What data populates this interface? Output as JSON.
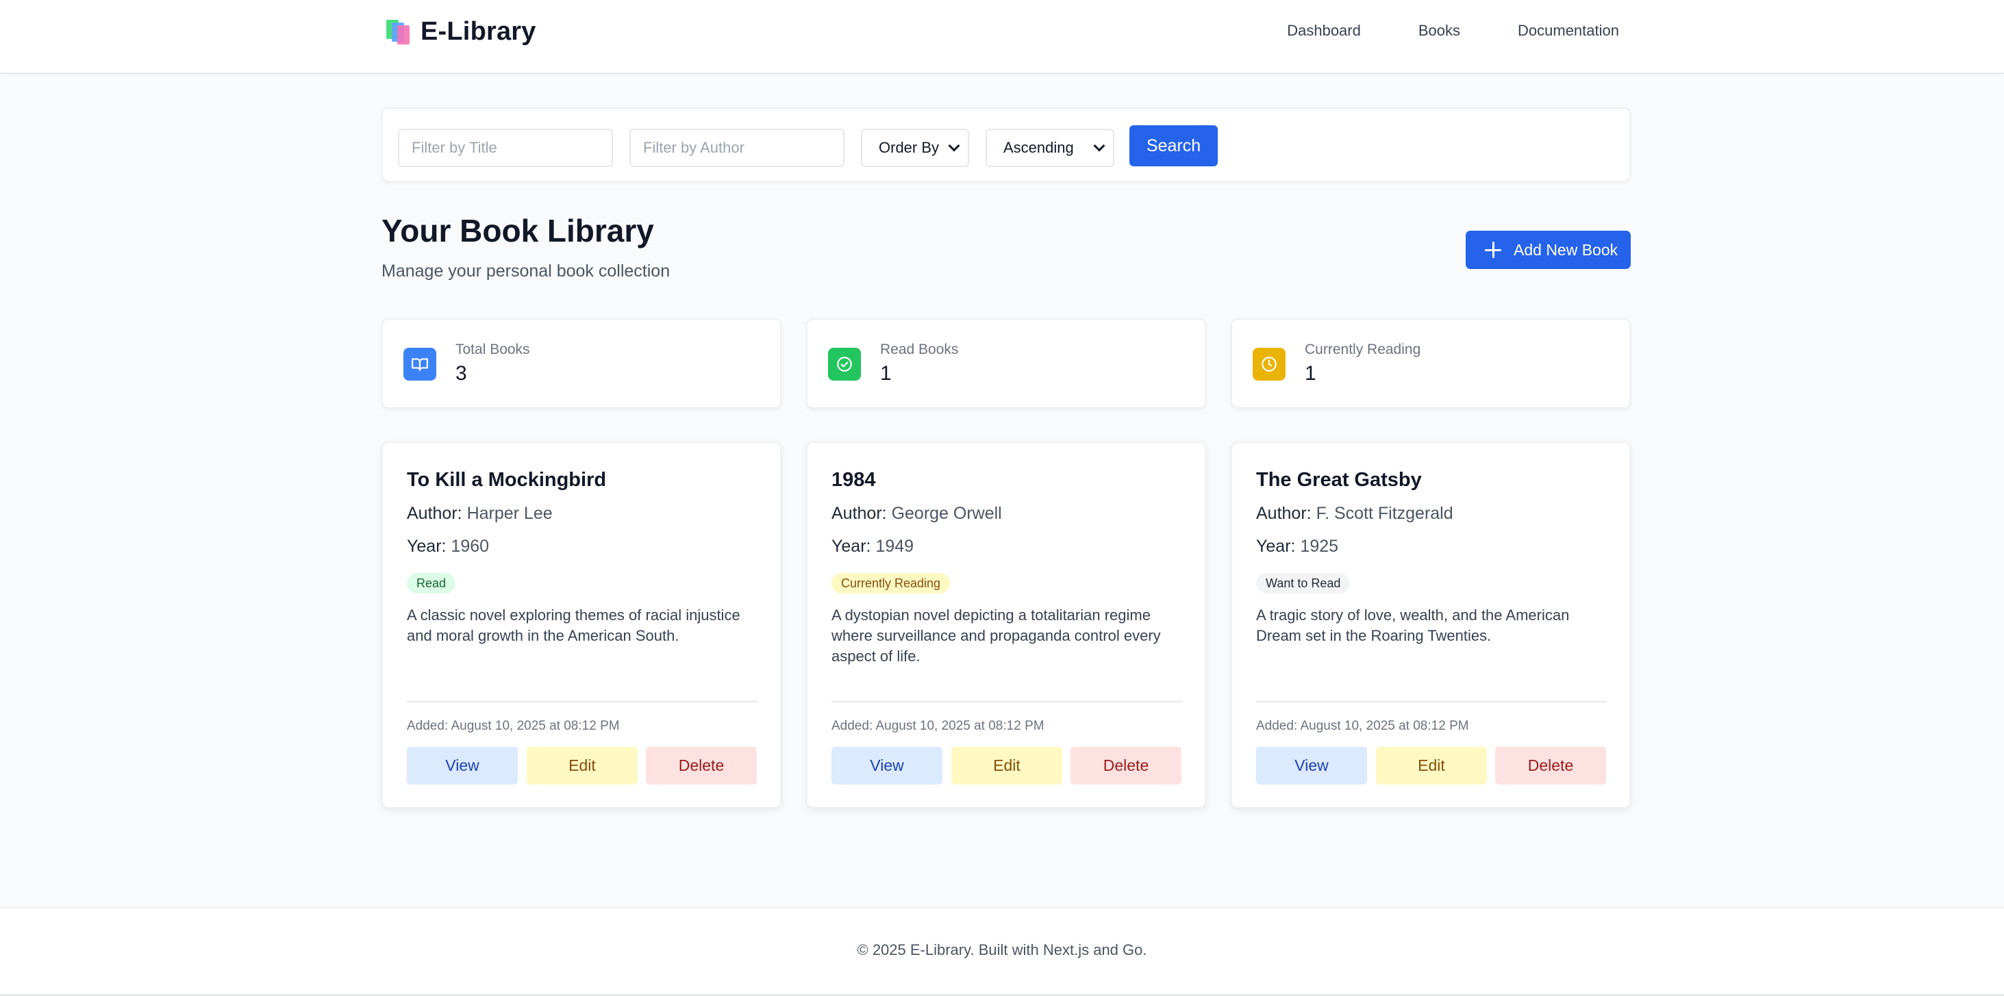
{
  "header": {
    "brand": "E-Library",
    "nav": [
      "Dashboard",
      "Books",
      "Documentation"
    ]
  },
  "filters": {
    "title_placeholder": "Filter by Title",
    "author_placeholder": "Filter by Author",
    "order_by": "Order By",
    "direction": "Ascending",
    "search_label": "Search"
  },
  "library": {
    "title": "Your Book Library",
    "subtitle": "Manage your personal book collection",
    "add_label": "Add New Book"
  },
  "stats": [
    {
      "label": "Total Books",
      "value": "3",
      "icon": "book-open-icon",
      "color": "#3b82f6"
    },
    {
      "label": "Read Books",
      "value": "1",
      "icon": "check-circle-icon",
      "color": "#22c55e"
    },
    {
      "label": "Currently Reading",
      "value": "1",
      "icon": "clock-icon",
      "color": "#eab308"
    }
  ],
  "books": [
    {
      "title": "To Kill a Mockingbird",
      "author_label": "Author:",
      "author": "Harper Lee",
      "year_label": "Year:",
      "year": "1960",
      "status": "Read",
      "description": "A classic novel exploring themes of racial injustice and moral growth in the American South.",
      "added": "Added: August 10, 2025 at 08:12 PM"
    },
    {
      "title": "1984",
      "author_label": "Author:",
      "author": "George Orwell",
      "year_label": "Year:",
      "year": "1949",
      "status": "Currently Reading",
      "description": "A dystopian novel depicting a totalitarian regime where surveillance and propaganda control every aspect of life.",
      "added": "Added: August 10, 2025 at 08:12 PM"
    },
    {
      "title": "The Great Gatsby",
      "author_label": "Author:",
      "author": "F. Scott Fitzgerald",
      "year_label": "Year:",
      "year": "1925",
      "status": "Want to Read",
      "description": "A tragic story of love, wealth, and the American Dream set in the Roaring Twenties.",
      "added": "Added: August 10, 2025 at 08:12 PM"
    }
  ],
  "actions": {
    "view": "View",
    "edit": "Edit",
    "delete": "Delete"
  },
  "footer": {
    "text": "© 2025 E-Library. Built with Next.js and Go."
  },
  "colors": {
    "primary": "#2563eb",
    "background": "#f9fafb"
  }
}
